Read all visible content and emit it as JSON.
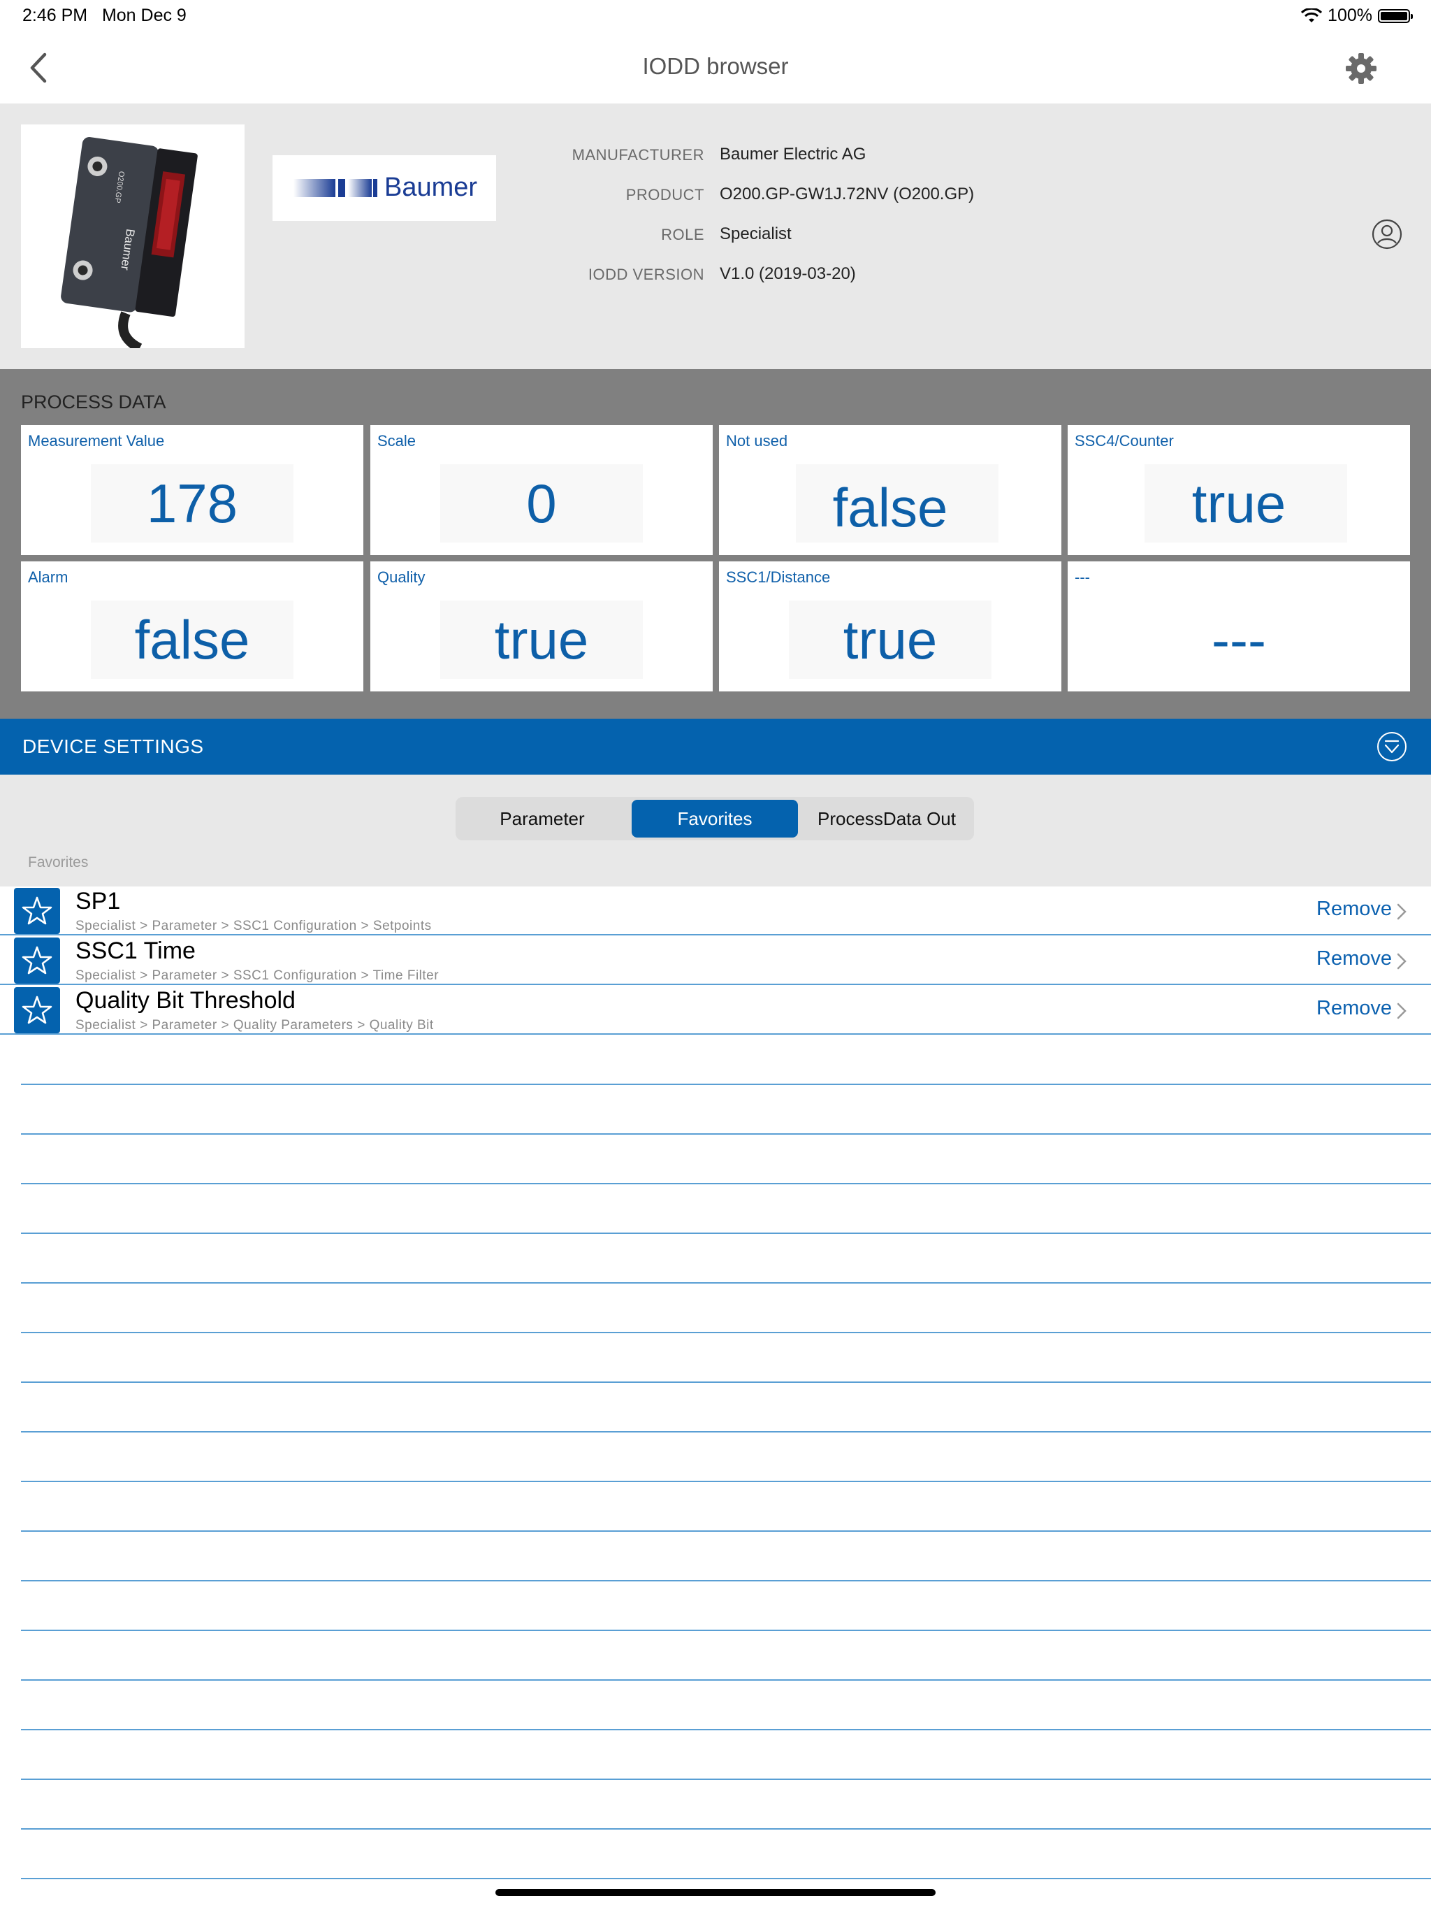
{
  "status_bar": {
    "time": "2:46 PM",
    "date": "Mon Dec 9",
    "battery": "100%"
  },
  "nav": {
    "title": "IODD browser",
    "back_icon": "chevron-left-icon",
    "settings_icon": "gear-icon"
  },
  "device": {
    "brand": "Baumer",
    "fields": [
      {
        "key": "MANUFACTURER",
        "value": "Baumer Electric AG"
      },
      {
        "key": "PRODUCT",
        "value": "O200.GP-GW1J.72NV (O200.GP)"
      },
      {
        "key": "ROLE",
        "value": "Specialist"
      },
      {
        "key": "IODD VERSION",
        "value": "V1.0 (2019-03-20)"
      }
    ],
    "photo_label": "O200.GP",
    "photo_brand": "Baumer"
  },
  "process_data": {
    "title": "PROCESS DATA",
    "tiles": [
      {
        "label": "Measurement Value",
        "value": "178"
      },
      {
        "label": "Scale",
        "value": "0"
      },
      {
        "label": "Not used",
        "value": "false"
      },
      {
        "label": "SSC4/Counter",
        "value": "true"
      },
      {
        "label": "Alarm",
        "value": "false"
      },
      {
        "label": "Quality",
        "value": "true"
      },
      {
        "label": "SSC1/Distance",
        "value": "true"
      },
      {
        "label": "---",
        "value": "---"
      }
    ]
  },
  "device_settings": {
    "title": "DEVICE SETTINGS",
    "tabs": [
      {
        "label": "Parameter",
        "active": false
      },
      {
        "label": "Favorites",
        "active": true
      },
      {
        "label": "ProcessData Out",
        "active": false
      }
    ],
    "section_caption": "Favorites",
    "favorites": [
      {
        "title": "SP1",
        "path": "Specialist > Parameter > SSC1 Configuration > Setpoints",
        "action": "Remove"
      },
      {
        "title": "SSC1 Time",
        "path": "Specialist > Parameter > SSC1 Configuration > Time Filter",
        "action": "Remove"
      },
      {
        "title": "Quality Bit Threshold",
        "path": "Specialist > Parameter > Quality Parameters > Quality Bit",
        "action": "Remove"
      }
    ]
  },
  "colors": {
    "accent": "#0462ae",
    "process_bg": "#808080",
    "header_bg": "#e8e8e8",
    "value_text": "#0d5fa8"
  }
}
